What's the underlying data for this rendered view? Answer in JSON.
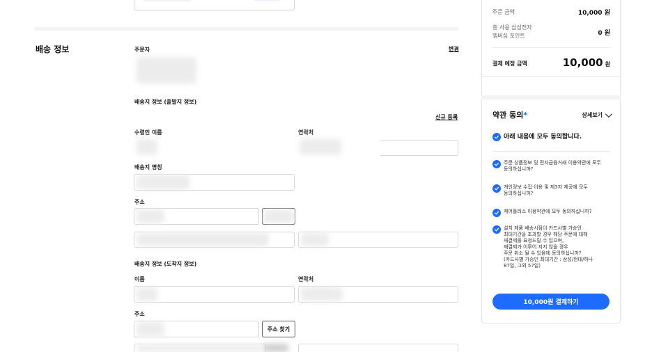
{
  "shipping": {
    "section_title": "배송 정보",
    "orderer_label": "주문자",
    "change_link": "변경",
    "sender_info_title": "배송지 정보 (출발지 정보)",
    "new_register_link": "신규 등록",
    "recipient_name_label": "수령인 이름",
    "contact_label": "연락처",
    "address_name_label": "배송지 명칭",
    "address_label": "주소",
    "receiver_info_title": "배송지 정보 (도착지 정보)",
    "name_label": "이름",
    "contact_label_2": "연락처",
    "address_label_2": "주소",
    "find_address_button": "주소 찾기"
  },
  "summary": {
    "order_amount_label": "주문 금액",
    "order_amount_value": "10,000 원",
    "points_label_line1": "총 사용 삼성전자",
    "points_label_line2": "멤버십 포인트",
    "points_value": "0 원",
    "expected_payment_label": "결제 예정 금액",
    "expected_payment_value": "10,000",
    "expected_payment_unit": "원"
  },
  "terms": {
    "title": "약관 동의",
    "required_mark": "*",
    "detail_toggle": "상세보기",
    "agree_all": "아래 내용에 모두 동의합니다.",
    "items": [
      [
        "주문 상품정보 및 전자금융거래 이용약관에 모두",
        "동의하십니까?"
      ],
      [
        "개인정보 수집·이용 및 제3자 제공에 모두",
        "동의하십니까?"
      ],
      [
        "케어플러스 이용약관에 모두 동의하십니까?"
      ],
      [
        "설치 제품 배송시점이 카드사별 가승인",
        "최대기간을 초과할 경우 해당 주문에 대해",
        "재결제를 요청드릴 수 있으며,",
        "재결제가 이루어 지지 않을 경우",
        "주문 취소 될 수 있음에 동의하십니까?",
        "(카드사별 가승인 최대기간 : 삼성/현대/하나",
        "87일, 그외 57일)"
      ]
    ],
    "pay_button": "10,000원 결제하기"
  },
  "colors": {
    "accent": "#1e6bff"
  }
}
